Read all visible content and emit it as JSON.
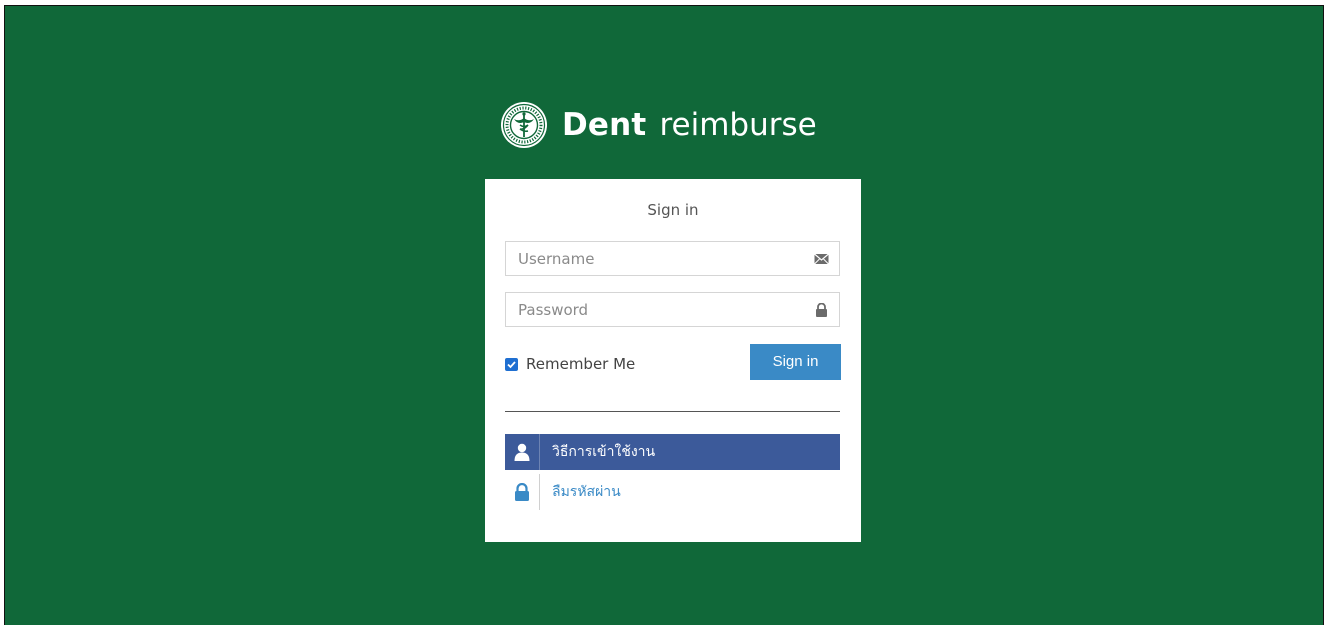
{
  "brand": {
    "name_bold": "Dent",
    "name_light": "reimburse",
    "logo_icon": "ministry-seal-icon"
  },
  "login": {
    "title": "Sign in",
    "username_placeholder": "Username",
    "username_value": "",
    "username_icon": "envelope-icon",
    "password_placeholder": "Password",
    "password_value": "",
    "password_icon": "lock-icon",
    "remember_label": "Remember Me",
    "remember_checked": true,
    "submit_label": "Sign in"
  },
  "links": [
    {
      "label": "วิธีการเข้าใช้งาน",
      "icon": "user-icon",
      "active": true
    },
    {
      "label": "ลืมรหัสผ่าน",
      "icon": "lock-icon",
      "active": false
    }
  ],
  "colors": {
    "background": "#106839",
    "card": "#ffffff",
    "button": "#3a8ac6",
    "active_link": "#3c5a9a",
    "checkbox": "#1f6fd1"
  }
}
